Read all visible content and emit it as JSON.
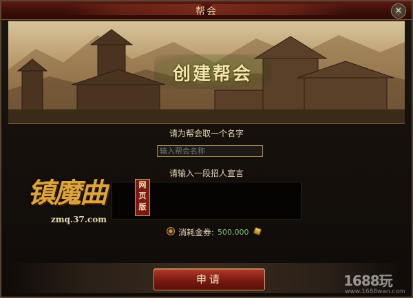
{
  "dialog": {
    "title": "帮会",
    "close_label": "×"
  },
  "banner": {
    "title": "创建帮会"
  },
  "form": {
    "name_prompt": "请为帮会取一个名字",
    "name_placeholder": "输入帮会名称",
    "recruit_prompt": "请输入一段招人宣言"
  },
  "cost": {
    "label": "消耗金券:",
    "value": "500,000",
    "icon": "gold-ticket-icon"
  },
  "actions": {
    "apply_label": "申请"
  },
  "logo": {
    "name": "镇魔曲",
    "url": "zmq.37.com",
    "stamp": "网页版"
  },
  "watermark": {
    "brand": "1688玩",
    "url": "www.1688wan.com"
  },
  "colors": {
    "title_bar": "#3a0e09",
    "button": "#7a1a12",
    "accent_gold": "#d9a53c",
    "cost_value": "#7fc47a"
  }
}
